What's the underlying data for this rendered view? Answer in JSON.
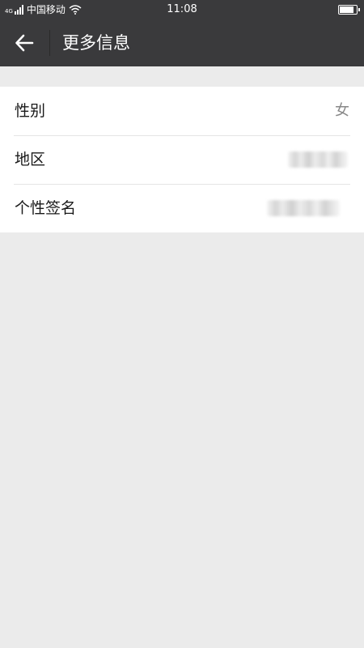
{
  "status_bar": {
    "network_type": "4G",
    "carrier": "中国移动",
    "time": "11:08",
    "icons": [
      "signal-icon",
      "wifi-icon",
      "battery-icon"
    ],
    "battery_level": 0.85
  },
  "header": {
    "back_icon": "back-arrow-icon",
    "title": "更多信息"
  },
  "info_list": [
    {
      "label": "性别",
      "value": "女"
    },
    {
      "label": "地区",
      "value": ""
    },
    {
      "label": "个性签名",
      "value": ""
    }
  ],
  "colors": {
    "header_background": "#3a3a3c",
    "page_background": "#ebebeb",
    "list_background": "#ffffff"
  }
}
